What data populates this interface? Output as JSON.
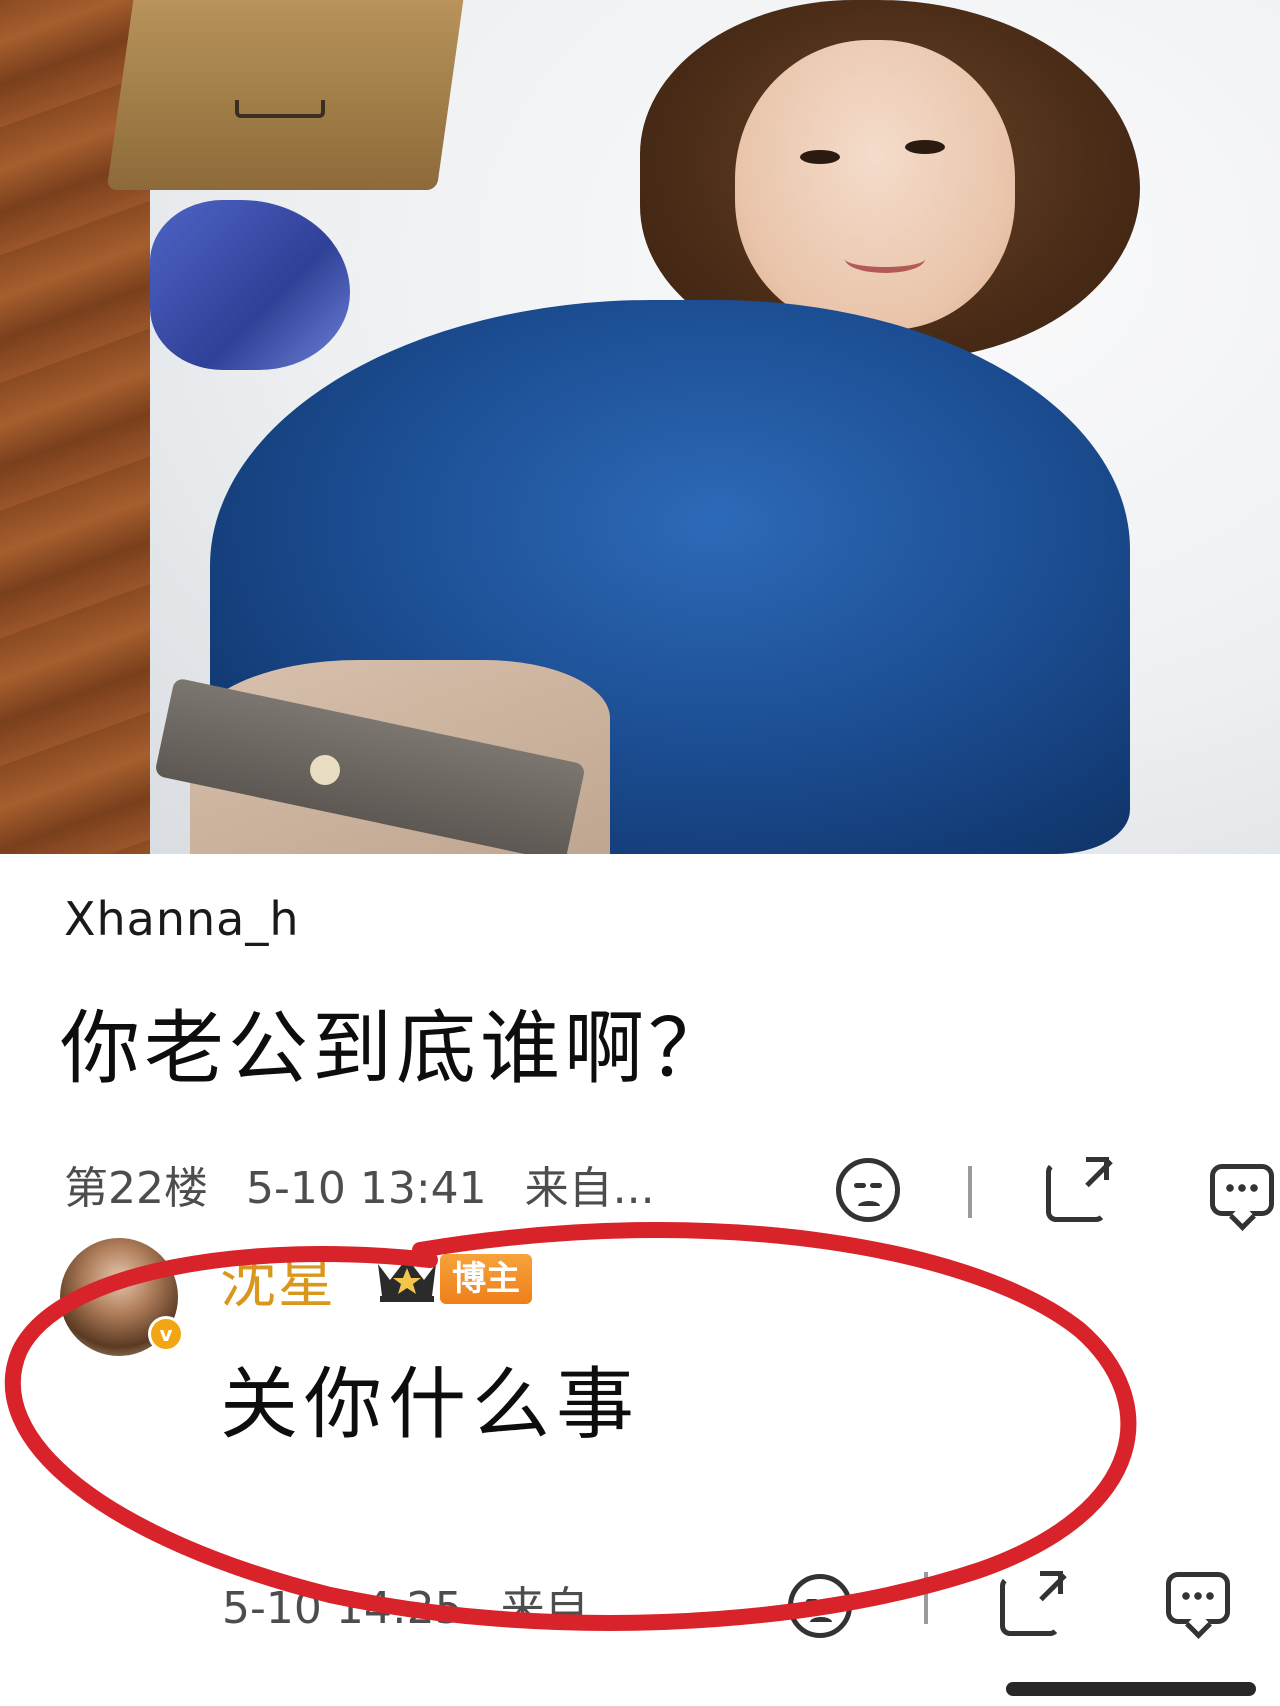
{
  "photo": {
    "description_icon": "photo"
  },
  "comments": [
    {
      "username": "Xhanna_h",
      "text": "你老公到底谁啊？",
      "floor": "第22楼",
      "time": "5-10 13:41",
      "source": "来自..."
    },
    {
      "username": "沈星",
      "badge": "博主",
      "avatar_badge": "v",
      "text": "关你什么事",
      "time": "5-10 14:25",
      "source": "来自..."
    }
  ],
  "colors": {
    "author_name": "#d9971d",
    "badge_bg": "#ee7f1b",
    "highlight_oval": "#d8232a"
  },
  "icons": [
    "sad-face-icon",
    "share-icon",
    "comment-icon",
    "crown-icon",
    "verified-icon"
  ]
}
